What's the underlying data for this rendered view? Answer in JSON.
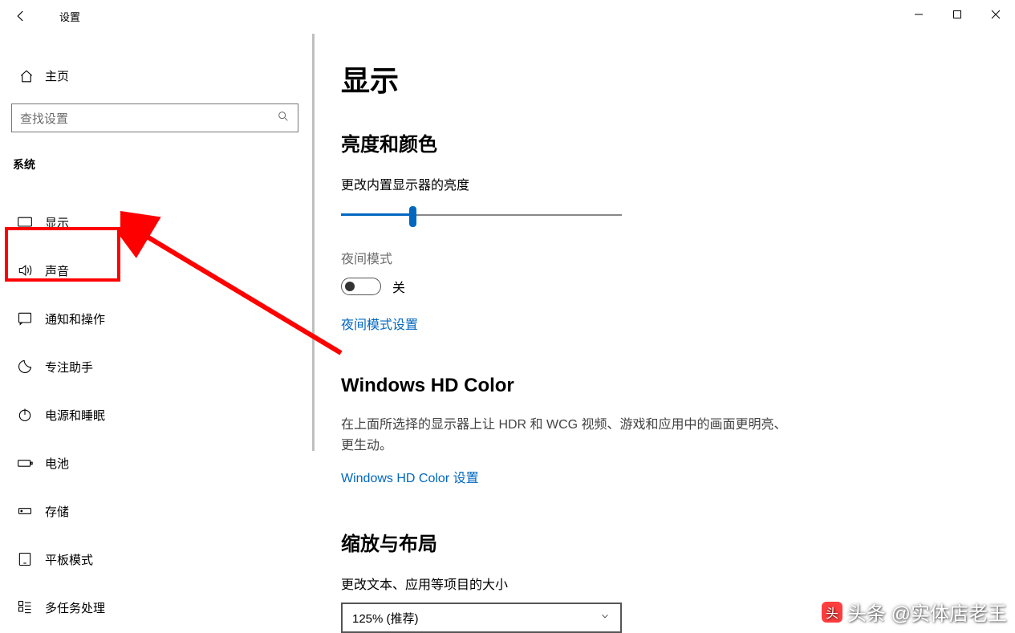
{
  "window": {
    "title": "设置"
  },
  "sidebar": {
    "home_label": "主页",
    "search_placeholder": "查找设置",
    "section_label": "系统",
    "items": [
      {
        "icon": "display",
        "label": "显示"
      },
      {
        "icon": "sound",
        "label": "声音"
      },
      {
        "icon": "notify",
        "label": "通知和操作"
      },
      {
        "icon": "focus",
        "label": "专注助手"
      },
      {
        "icon": "power",
        "label": "电源和睡眠"
      },
      {
        "icon": "battery",
        "label": "电池"
      },
      {
        "icon": "storage",
        "label": "存储"
      },
      {
        "icon": "tablet",
        "label": "平板模式"
      },
      {
        "icon": "multitask",
        "label": "多任务处理"
      }
    ]
  },
  "content": {
    "page_title": "显示",
    "brightness": {
      "heading": "亮度和颜色",
      "slider_label": "更改内置显示器的亮度",
      "night_mode_label": "夜间模式",
      "night_mode_state": "关",
      "night_mode_link": "夜间模式设置"
    },
    "hdcolor": {
      "heading": "Windows HD Color",
      "description": "在上面所选择的显示器上让 HDR 和 WCG 视频、游戏和应用中的画面更明亮、更生动。",
      "link": "Windows HD Color 设置"
    },
    "scale": {
      "heading": "缩放与布局",
      "label": "更改文本、应用等项目的大小",
      "dropdown_value": "125% (推荐)"
    }
  },
  "watermark": "头条 @实体店老王"
}
